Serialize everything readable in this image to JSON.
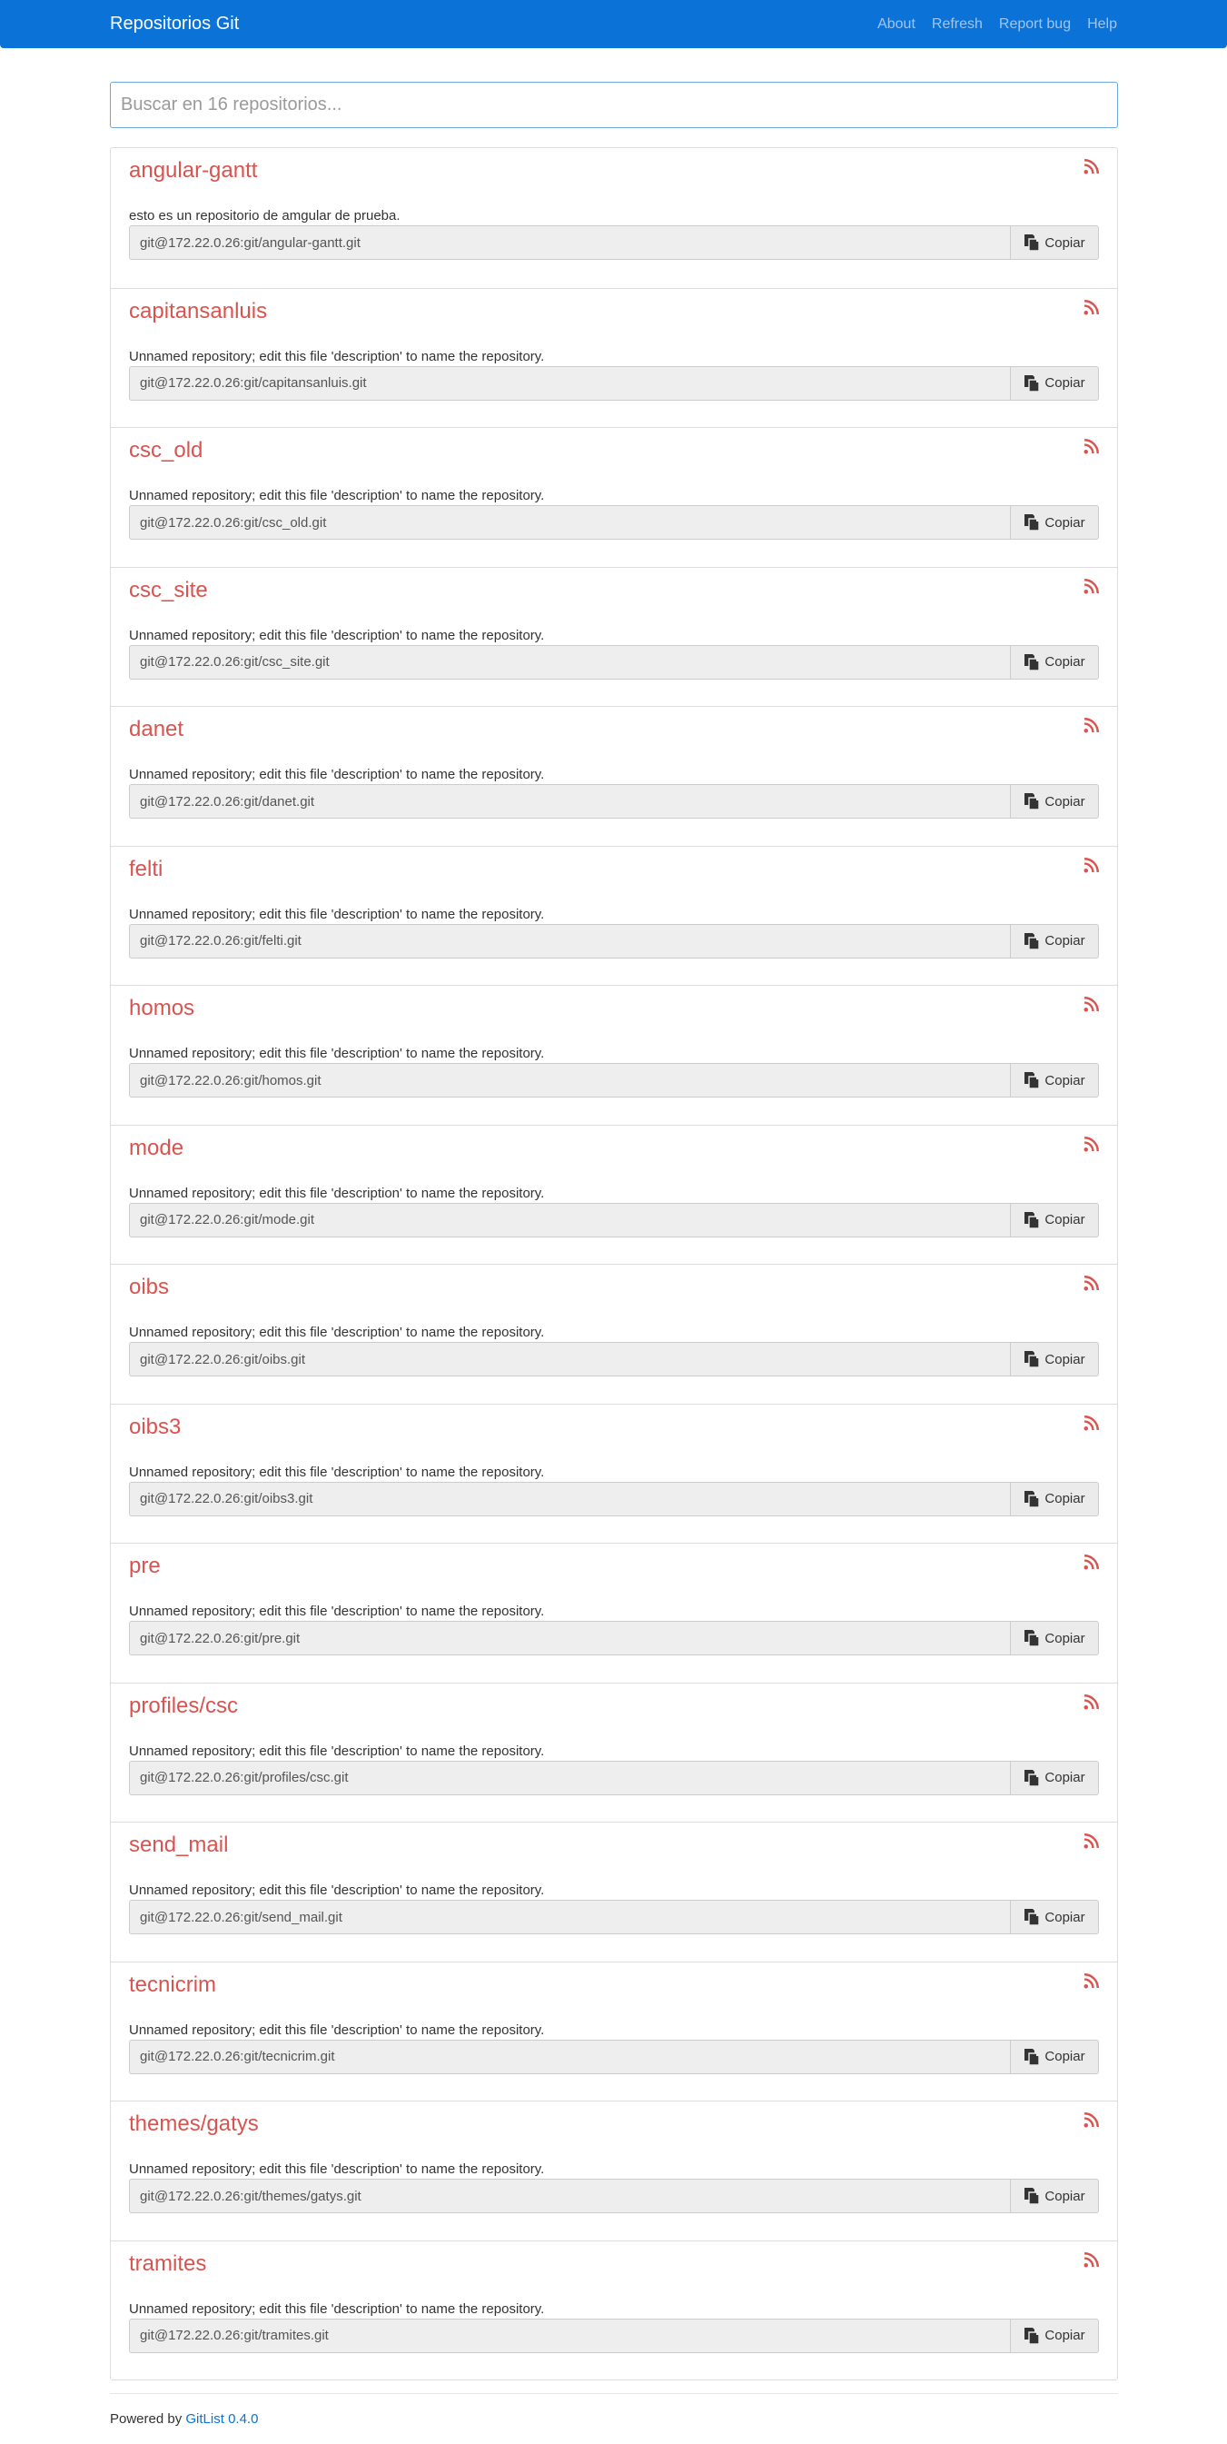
{
  "navbar": {
    "brand": "Repositorios Git",
    "links": [
      "About",
      "Refresh",
      "Report bug",
      "Help"
    ]
  },
  "search": {
    "placeholder": "Buscar en 16 repositorios..."
  },
  "copy_label": "Copiar",
  "repositories": [
    {
      "name": "angular-gantt",
      "description": "esto es un repositorio de amgular de prueba.",
      "clone_url": "git@172.22.0.26:git/angular-gantt.git"
    },
    {
      "name": "capitansanluis",
      "description": "Unnamed repository; edit this file 'description' to name the repository.",
      "clone_url": "git@172.22.0.26:git/capitansanluis.git"
    },
    {
      "name": "csc_old",
      "description": "Unnamed repository; edit this file 'description' to name the repository.",
      "clone_url": "git@172.22.0.26:git/csc_old.git"
    },
    {
      "name": "csc_site",
      "description": "Unnamed repository; edit this file 'description' to name the repository.",
      "clone_url": "git@172.22.0.26:git/csc_site.git"
    },
    {
      "name": "danet",
      "description": "Unnamed repository; edit this file 'description' to name the repository.",
      "clone_url": "git@172.22.0.26:git/danet.git"
    },
    {
      "name": "felti",
      "description": "Unnamed repository; edit this file 'description' to name the repository.",
      "clone_url": "git@172.22.0.26:git/felti.git"
    },
    {
      "name": "homos",
      "description": "Unnamed repository; edit this file 'description' to name the repository.",
      "clone_url": "git@172.22.0.26:git/homos.git"
    },
    {
      "name": "mode",
      "description": "Unnamed repository; edit this file 'description' to name the repository.",
      "clone_url": "git@172.22.0.26:git/mode.git"
    },
    {
      "name": "oibs",
      "description": "Unnamed repository; edit this file 'description' to name the repository.",
      "clone_url": "git@172.22.0.26:git/oibs.git"
    },
    {
      "name": "oibs3",
      "description": "Unnamed repository; edit this file 'description' to name the repository.",
      "clone_url": "git@172.22.0.26:git/oibs3.git"
    },
    {
      "name": "pre",
      "description": "Unnamed repository; edit this file 'description' to name the repository.",
      "clone_url": "git@172.22.0.26:git/pre.git"
    },
    {
      "name": "profiles/csc",
      "description": "Unnamed repository; edit this file 'description' to name the repository.",
      "clone_url": "git@172.22.0.26:git/profiles/csc.git"
    },
    {
      "name": "send_mail",
      "description": "Unnamed repository; edit this file 'description' to name the repository.",
      "clone_url": "git@172.22.0.26:git/send_mail.git"
    },
    {
      "name": "tecnicrim",
      "description": "Unnamed repository; edit this file 'description' to name the repository.",
      "clone_url": "git@172.22.0.26:git/tecnicrim.git"
    },
    {
      "name": "themes/gatys",
      "description": "Unnamed repository; edit this file 'description' to name the repository.",
      "clone_url": "git@172.22.0.26:git/themes/gatys.git"
    },
    {
      "name": "tramites",
      "description": "Unnamed repository; edit this file 'description' to name the repository.",
      "clone_url": "git@172.22.0.26:git/tramites.git"
    }
  ],
  "footer": {
    "powered_by": "Powered by",
    "link_label": "GitList 0.4.0"
  },
  "colors": {
    "navbar": "#0b72d8",
    "repo_name": "#d9534f",
    "rss_icon": "#d9534f",
    "link": "#0b72d8"
  },
  "icons": {
    "feed": "rss-icon",
    "copy": "copy-icon"
  }
}
